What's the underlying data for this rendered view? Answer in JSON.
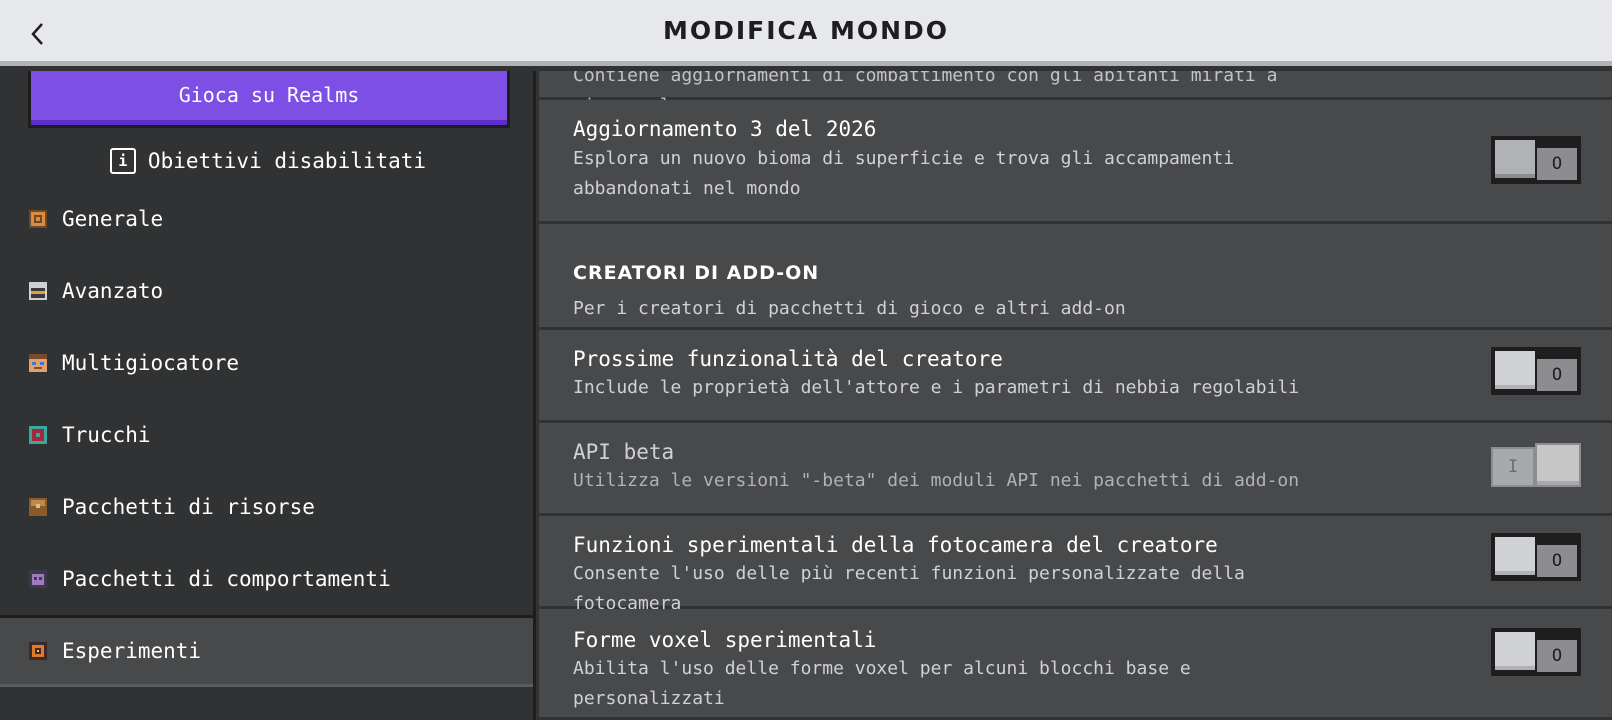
{
  "header": {
    "title": "MODIFICA MONDO",
    "back_icon": "chevron-left-icon"
  },
  "sidebar": {
    "realms_button": "Gioca su Realms",
    "objectives_label": "Obiettivi disabilitati",
    "objectives_icon_glyph": "i",
    "items": [
      {
        "label": "Generale",
        "icon": "gear-icon",
        "active": false
      },
      {
        "label": "Avanzato",
        "icon": "chest-icon",
        "active": false
      },
      {
        "label": "Multigiocatore",
        "icon": "player-face-icon",
        "active": false
      },
      {
        "label": "Trucchi",
        "icon": "cheat-block-icon",
        "active": false
      },
      {
        "label": "Pacchetti di risorse",
        "icon": "resource-pack-icon",
        "active": false
      },
      {
        "label": "Pacchetti di comportamenti",
        "icon": "behavior-pack-icon",
        "active": false
      },
      {
        "label": "Esperimenti",
        "icon": "experiment-icon",
        "active": true
      }
    ]
  },
  "content": {
    "partial_row_desc": "Contiene aggiornamenti di combattimento con gli abitanti mirati a rinnovarlo",
    "row_update": {
      "title": "Aggiornamento 3 del 2026",
      "desc1": "Esplora un nuovo bioma di superficie e trova gli accampamenti",
      "desc2": "abbandonati nel mondo",
      "toggle_glyph": "O",
      "enabled": false
    },
    "section": {
      "title": "CREATORI DI ADD-ON",
      "subtitle": "Per i creatori di pacchetti di gioco e altri add-on"
    },
    "rows": [
      {
        "title": "Prossime funzionalità del creatore",
        "desc": "Include le proprietà dell'attore e i parametri di nebbia regolabili",
        "glyph": "O",
        "enabled": false,
        "disabled": false
      },
      {
        "title": "API beta",
        "desc": "Utilizza le versioni \"-beta\" dei moduli API nei pacchetti di add-on",
        "glyph": "I",
        "enabled": true,
        "disabled": true
      },
      {
        "title": "Funzioni sperimentali della fotocamera del creatore",
        "desc": "Consente l'uso delle più recenti funzioni personalizzate della fotocamera",
        "glyph": "O",
        "enabled": false,
        "disabled": false
      },
      {
        "title": "Forme voxel sperimentali",
        "desc": "Abilita l'uso delle forme voxel per alcuni blocchi base e personalizzati",
        "glyph": "O",
        "enabled": false,
        "disabled": false
      }
    ]
  },
  "colors": {
    "header_bg": "#e6e8eb",
    "panel_bg": "#313233",
    "row_bg": "#48494a",
    "realms_purple": "#7d4fe5"
  }
}
